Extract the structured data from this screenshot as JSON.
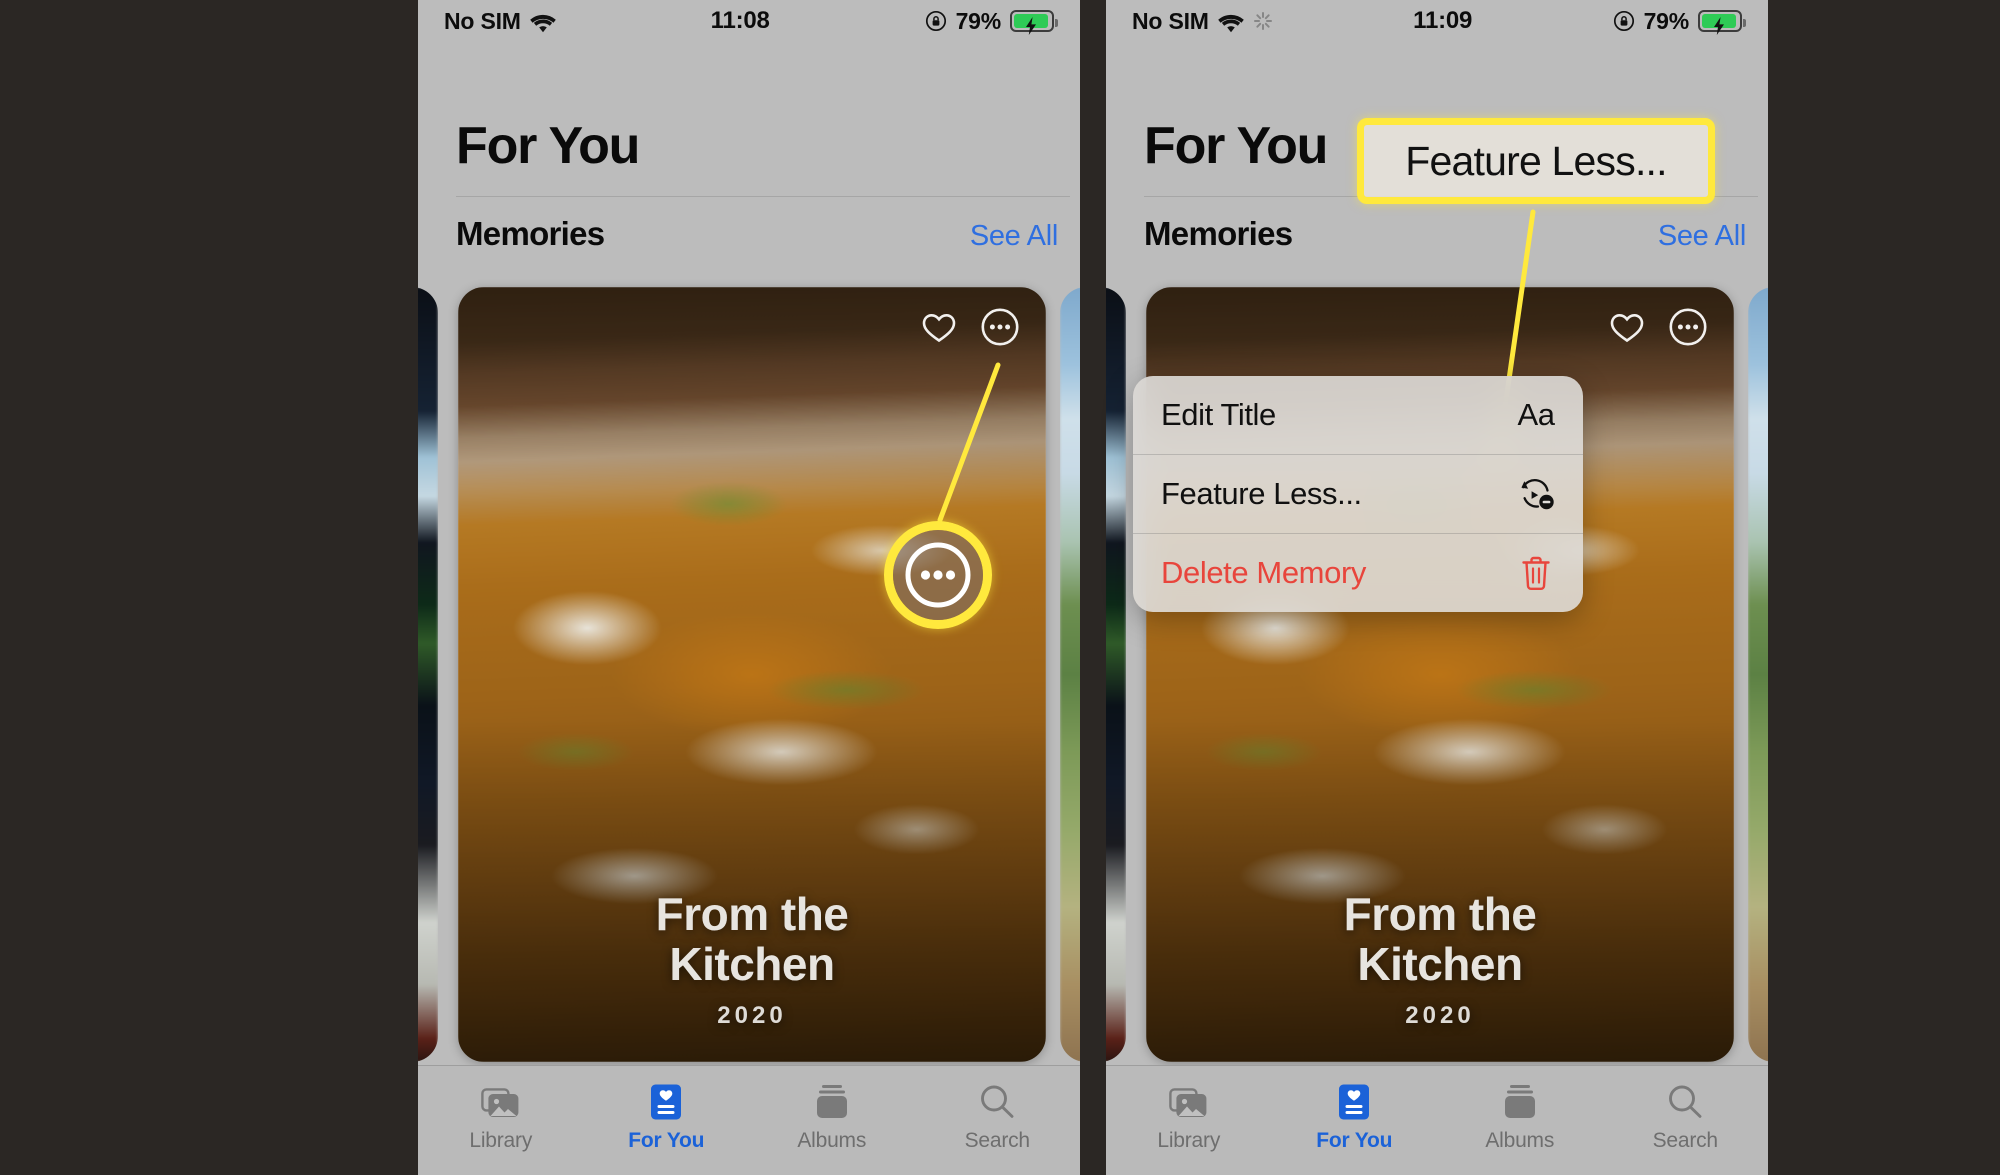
{
  "background_color": "#2b2724",
  "accent_highlight_color": "#ffe93d",
  "link_color": "#2f6fe0",
  "destructive_color": "#e8453c",
  "panels": [
    {
      "id": "left",
      "status_bar": {
        "carrier": "No SIM",
        "wifi_icon": "wifi-icon",
        "spinner_icon": null,
        "time": "11:08",
        "rotation_lock_icon": "rotation-lock-icon",
        "battery_percent": "79%",
        "battery_icon": "battery-charging-icon"
      },
      "header": {
        "title": "For You"
      },
      "section": {
        "title": "Memories",
        "see_all": "See All"
      },
      "memory_card": {
        "title_line1": "From the",
        "title_line2": "Kitchen",
        "year": "2020",
        "heart_icon": "heart-icon",
        "more_icon": "ellipsis-circle-icon"
      },
      "tabs": [
        {
          "label": "Library",
          "icon": "photos-stack-icon",
          "active": false
        },
        {
          "label": "For You",
          "icon": "for-you-card-icon",
          "active": true
        },
        {
          "label": "Albums",
          "icon": "albums-stack-icon",
          "active": false
        },
        {
          "label": "Search",
          "icon": "search-icon",
          "active": false
        }
      ]
    },
    {
      "id": "right",
      "status_bar": {
        "carrier": "No SIM",
        "wifi_icon": "wifi-icon",
        "spinner_icon": "activity-spinner-icon",
        "time": "11:09",
        "rotation_lock_icon": "rotation-lock-icon",
        "battery_percent": "79%",
        "battery_icon": "battery-charging-icon"
      },
      "header": {
        "title": "For You"
      },
      "section": {
        "title": "Memories",
        "see_all": "See All"
      },
      "memory_card": {
        "title_line1": "From the",
        "title_line2": "Kitchen",
        "year": "2020",
        "heart_icon": "heart-icon",
        "more_icon": "ellipsis-circle-icon"
      },
      "context_menu": {
        "items": [
          {
            "label": "Edit Title",
            "icon": "aa-text-icon",
            "destructive": false
          },
          {
            "label": "Feature Less...",
            "icon": "feature-less-icon",
            "destructive": false
          },
          {
            "label": "Delete Memory",
            "icon": "trash-icon",
            "destructive": true
          }
        ]
      },
      "tabs": [
        {
          "label": "Library",
          "icon": "photos-stack-icon",
          "active": false
        },
        {
          "label": "For You",
          "icon": "for-you-card-icon",
          "active": true
        },
        {
          "label": "Albums",
          "icon": "albums-stack-icon",
          "active": false
        },
        {
          "label": "Search",
          "icon": "search-icon",
          "active": false
        }
      ]
    }
  ],
  "annotations": {
    "left_circle_target": "ellipsis-circle-icon",
    "right_callout_label": "Feature Less..."
  }
}
